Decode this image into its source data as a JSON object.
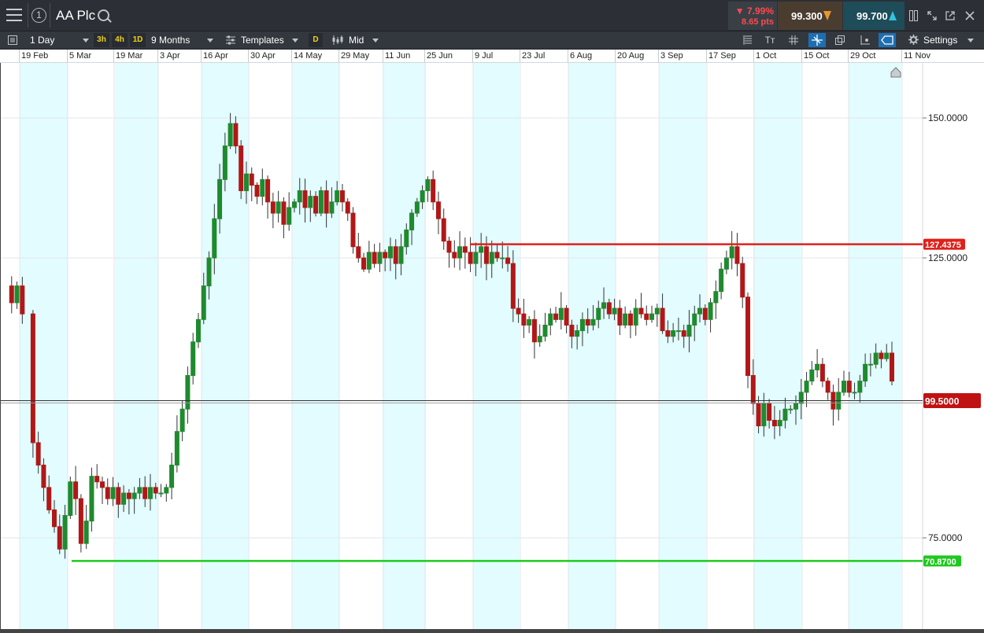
{
  "window": {
    "instrument": "AA Plc",
    "info_icon_label": "1",
    "change_pct": "▼ 7.99%",
    "change_pts": "8.65 pts",
    "sell_price": "99.300",
    "buy_price": "99.700"
  },
  "toolbar": {
    "interval": "1 Day",
    "quick_intervals": [
      "3h",
      "4h",
      "1D"
    ],
    "range": "9 Months",
    "templates": "Templates",
    "d_chip": "D",
    "price_type": "Mid",
    "settings": "Settings",
    "icons": [
      "list-icon",
      "text-size-icon",
      "grid-icon",
      "crosshair-icon",
      "layers-icon",
      "drawing-icon",
      "ticket-icon",
      "gear-icon"
    ]
  },
  "date_axis": {
    "labels": [
      "19 Feb",
      "5 Mar",
      "19 Mar",
      "3 Apr",
      "16 Apr",
      "30 Apr",
      "14 May",
      "29 May",
      "11 Jun",
      "25 Jun",
      "9 Jul",
      "23 Jul",
      "6 Aug",
      "20 Aug",
      "3 Sep",
      "17 Sep",
      "1 Oct",
      "15 Oct",
      "29 Oct",
      "11 Nov"
    ]
  },
  "price_axis": {
    "ticks": [
      "150.0000",
      "125.0000",
      "75.0000"
    ]
  },
  "levels": {
    "resistance": {
      "label": "127.4375",
      "value": 127.4375,
      "color": "#e0201b"
    },
    "current": {
      "label": "99.5000",
      "value": 99.5,
      "color": "#c01212"
    },
    "support": {
      "label": "70.8700",
      "value": 70.87,
      "color": "#1ec91e"
    }
  },
  "colors": {
    "up": "#1f8a2e",
    "down": "#b01818",
    "band": "#e2fcff",
    "grid": "#e3e6e9"
  },
  "chart_data": {
    "type": "candlestick",
    "x": [
      "19 Feb",
      "5 Mar",
      "19 Mar",
      "3 Apr",
      "16 Apr",
      "30 Apr",
      "14 May",
      "29 May",
      "11 Jun",
      "25 Jun",
      "9 Jul",
      "23 Jul",
      "6 Aug",
      "20 Aug",
      "3 Sep",
      "17 Sep",
      "1 Oct",
      "15 Oct",
      "29 Oct",
      "11 Nov"
    ],
    "close_path": [
      [
        0,
        120
      ],
      [
        1,
        117
      ],
      [
        2,
        120
      ],
      [
        3,
        115
      ],
      [
        5,
        92
      ],
      [
        6,
        88
      ],
      [
        7,
        84
      ],
      [
        8,
        80
      ],
      [
        9,
        77
      ],
      [
        10,
        73
      ],
      [
        11,
        79
      ],
      [
        12,
        85
      ],
      [
        13,
        82
      ],
      [
        14,
        74
      ],
      [
        15,
        78
      ],
      [
        16,
        86
      ],
      [
        17,
        85
      ],
      [
        18,
        84
      ],
      [
        19,
        82
      ],
      [
        20,
        84
      ],
      [
        21,
        81
      ],
      [
        22,
        83
      ],
      [
        23,
        82
      ],
      [
        24,
        83
      ],
      [
        25,
        84
      ],
      [
        26,
        82
      ],
      [
        27,
        84
      ],
      [
        28,
        83
      ],
      [
        29,
        83
      ],
      [
        30,
        84
      ],
      [
        31,
        88
      ],
      [
        32,
        94
      ],
      [
        33,
        98
      ],
      [
        34,
        104
      ],
      [
        35,
        110
      ],
      [
        36,
        114
      ],
      [
        37,
        120
      ],
      [
        38,
        125
      ],
      [
        39,
        132
      ],
      [
        40,
        139
      ],
      [
        41,
        145
      ],
      [
        42,
        149
      ],
      [
        43,
        145
      ],
      [
        44,
        137
      ],
      [
        45,
        140
      ],
      [
        46,
        138
      ],
      [
        47,
        136
      ],
      [
        48,
        139
      ],
      [
        49,
        135
      ],
      [
        50,
        133
      ],
      [
        51,
        135
      ],
      [
        52,
        131
      ],
      [
        53,
        134
      ],
      [
        54,
        135
      ],
      [
        55,
        137
      ],
      [
        56,
        134
      ],
      [
        57,
        136
      ],
      [
        58,
        133
      ],
      [
        59,
        137
      ],
      [
        60,
        133
      ],
      [
        61,
        135
      ],
      [
        62,
        137
      ],
      [
        63,
        135
      ],
      [
        64,
        133
      ],
      [
        65,
        127
      ],
      [
        66,
        125
      ],
      [
        67,
        123
      ],
      [
        68,
        126
      ],
      [
        69,
        124
      ],
      [
        70,
        126
      ],
      [
        71,
        125
      ],
      [
        72,
        127
      ],
      [
        73,
        124
      ],
      [
        74,
        127
      ],
      [
        75,
        130
      ],
      [
        76,
        133
      ],
      [
        77,
        135
      ],
      [
        78,
        137
      ],
      [
        79,
        139
      ],
      [
        80,
        135
      ],
      [
        81,
        132
      ],
      [
        82,
        128
      ],
      [
        83,
        126
      ],
      [
        84,
        125
      ],
      [
        85,
        127
      ],
      [
        86,
        126
      ],
      [
        87,
        124
      ],
      [
        88,
        126
      ],
      [
        89,
        127
      ],
      [
        90,
        124
      ],
      [
        91,
        126
      ],
      [
        92,
        125
      ],
      [
        93,
        125
      ],
      [
        94,
        124
      ],
      [
        95,
        116
      ],
      [
        96,
        115
      ],
      [
        97,
        113
      ],
      [
        98,
        114
      ],
      [
        99,
        110
      ],
      [
        100,
        111
      ],
      [
        101,
        113
      ],
      [
        102,
        115
      ],
      [
        103,
        114
      ],
      [
        104,
        116
      ],
      [
        105,
        113
      ],
      [
        106,
        111
      ],
      [
        107,
        112
      ],
      [
        108,
        114
      ],
      [
        109,
        113
      ],
      [
        110,
        114
      ],
      [
        111,
        116
      ],
      [
        112,
        117
      ],
      [
        113,
        115
      ],
      [
        114,
        116
      ],
      [
        115,
        113
      ],
      [
        116,
        115
      ],
      [
        117,
        113
      ],
      [
        118,
        116
      ],
      [
        119,
        115
      ],
      [
        120,
        114
      ],
      [
        121,
        115
      ],
      [
        122,
        116
      ],
      [
        123,
        112
      ],
      [
        124,
        111
      ],
      [
        125,
        112
      ],
      [
        126,
        112
      ],
      [
        127,
        111
      ],
      [
        128,
        113
      ],
      [
        129,
        115
      ],
      [
        130,
        116
      ],
      [
        131,
        114
      ],
      [
        132,
        117
      ],
      [
        133,
        119
      ],
      [
        134,
        123
      ],
      [
        135,
        125
      ],
      [
        136,
        127
      ],
      [
        137,
        124
      ],
      [
        138,
        118
      ],
      [
        139,
        104
      ],
      [
        140,
        99
      ],
      [
        141,
        95
      ],
      [
        142,
        99
      ],
      [
        143,
        96
      ],
      [
        144,
        95
      ],
      [
        145,
        96
      ],
      [
        146,
        98
      ],
      [
        147,
        98
      ],
      [
        148,
        99
      ],
      [
        149,
        101
      ],
      [
        150,
        103
      ],
      [
        151,
        105
      ],
      [
        152,
        106
      ],
      [
        153,
        103
      ],
      [
        154,
        101
      ],
      [
        155,
        98
      ],
      [
        156,
        101
      ],
      [
        157,
        103
      ],
      [
        158,
        101
      ],
      [
        159,
        101
      ],
      [
        160,
        103
      ],
      [
        161,
        106
      ],
      [
        162,
        106
      ],
      [
        163,
        108
      ],
      [
        164,
        107
      ],
      [
        165,
        108
      ],
      [
        166,
        103
      ]
    ],
    "ylim": [
      62,
      162
    ],
    "price_ticks": [
      150,
      125,
      75
    ],
    "hlines": [
      127.4375,
      99.5,
      70.87
    ]
  }
}
